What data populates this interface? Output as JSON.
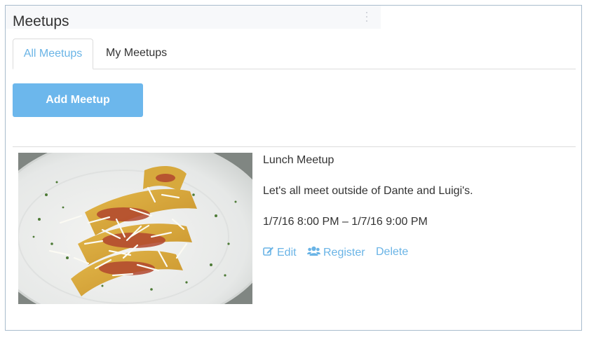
{
  "app": {
    "title": "Meetups"
  },
  "tabs": [
    {
      "label": "All Meetups",
      "active": true
    },
    {
      "label": "My Meetups",
      "active": false
    }
  ],
  "toolbar": {
    "add_label": "Add Meetup"
  },
  "meetup": {
    "image_alt": "plated crepes with grated cheese and herbs",
    "title": "Lunch Meetup",
    "description": "Let's all meet outside of Dante and Luigi's.",
    "time": "1/7/16 8:00 PM – 1/7/16 9:00 PM",
    "actions": {
      "edit": "Edit",
      "register": "Register",
      "delete": "Delete"
    }
  },
  "colors": {
    "accent": "#6ab4e6",
    "button": "#6cb7ec",
    "border": "#a9bccd"
  },
  "icons": {
    "edit": "edit-icon",
    "register": "users-icon",
    "menu": "kebab-menu-icon"
  }
}
